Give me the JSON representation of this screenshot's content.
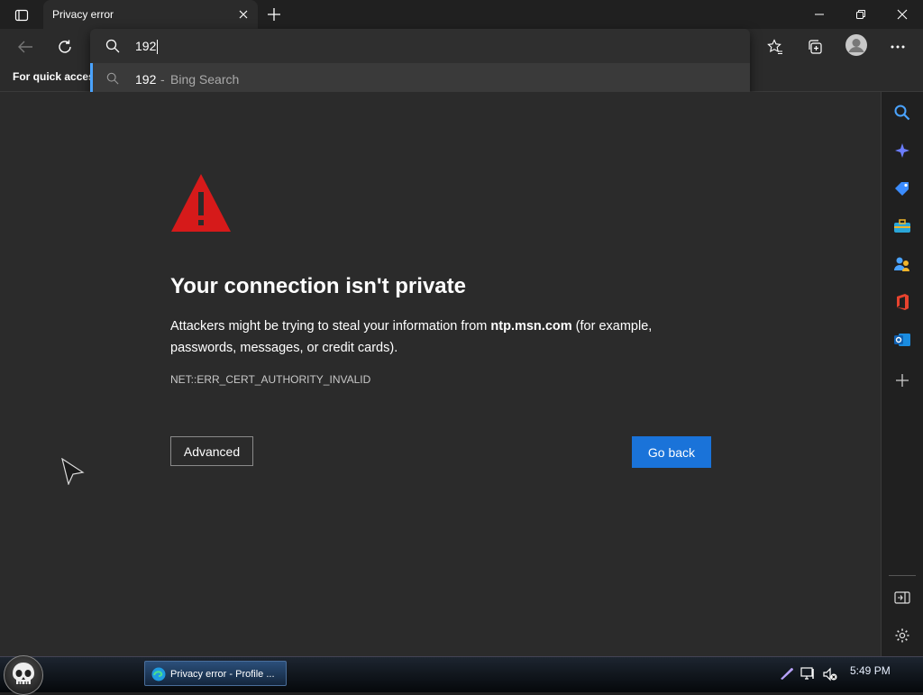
{
  "tab": {
    "title": "Privacy error"
  },
  "omnibox": {
    "query": "192",
    "suggestion_term": "192",
    "suggestion_separator": "-",
    "suggestion_engine": "Bing Search"
  },
  "favorites_bar": {
    "text": "For quick access"
  },
  "error_page": {
    "heading": "Your connection isn't private",
    "para_before": "Attackers might be trying to steal your information from ",
    "domain": "ntp.msn.com",
    "para_after": " (for example, passwords, messages, or credit cards).",
    "error_code": "NET::ERR_CERT_AUTHORITY_INVALID",
    "advanced_label": "Advanced",
    "go_back_label": "Go back"
  },
  "taskbar": {
    "task_label": "Privacy error - Profile ...",
    "clock": "5:49 PM"
  },
  "colors": {
    "accent": "#1a73d9",
    "warning": "#d61a1a",
    "page_bg": "#2b2b2b"
  },
  "icons": [
    "tab-actions-icon",
    "close-icon",
    "plus-icon",
    "minimize-icon",
    "restore-icon",
    "back-icon",
    "refresh-icon",
    "search-icon",
    "favorites-icon",
    "collections-icon",
    "profile-icon",
    "more-icon",
    "warning-icon",
    "sparkle-icon",
    "tag-icon",
    "briefcase-icon",
    "people-icon",
    "office-icon",
    "outlook-icon",
    "sidebar-collapse-icon",
    "settings-icon",
    "skull-start-icon",
    "edge-icon",
    "pen-icon",
    "network-icon",
    "volume-muted-icon"
  ]
}
